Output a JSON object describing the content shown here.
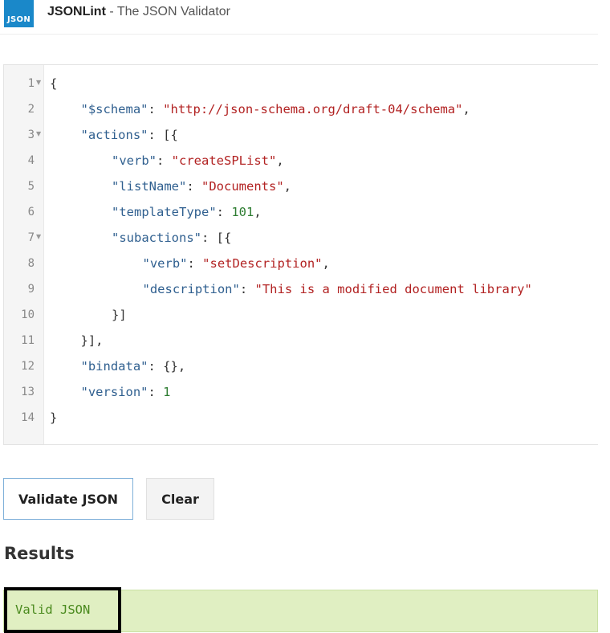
{
  "header": {
    "logo_text": "JSON",
    "brand": "JSONLint",
    "separator": " - ",
    "subtitle": "The JSON Validator"
  },
  "editor": {
    "lines": [
      {
        "num": "1",
        "fold": true,
        "indent": 0,
        "tokens": [
          {
            "t": "{",
            "c": "p"
          }
        ]
      },
      {
        "num": "2",
        "fold": false,
        "indent": 1,
        "tokens": [
          {
            "t": "\"$schema\"",
            "c": "key"
          },
          {
            "t": ": ",
            "c": "p"
          },
          {
            "t": "\"http://json-schema.org/draft-04/schema\"",
            "c": "str"
          },
          {
            "t": ",",
            "c": "p"
          }
        ]
      },
      {
        "num": "3",
        "fold": true,
        "indent": 1,
        "tokens": [
          {
            "t": "\"actions\"",
            "c": "key"
          },
          {
            "t": ": [{",
            "c": "p"
          }
        ]
      },
      {
        "num": "4",
        "fold": false,
        "indent": 2,
        "tokens": [
          {
            "t": "\"verb\"",
            "c": "key"
          },
          {
            "t": ": ",
            "c": "p"
          },
          {
            "t": "\"createSPList\"",
            "c": "str"
          },
          {
            "t": ",",
            "c": "p"
          }
        ]
      },
      {
        "num": "5",
        "fold": false,
        "indent": 2,
        "tokens": [
          {
            "t": "\"listName\"",
            "c": "key"
          },
          {
            "t": ": ",
            "c": "p"
          },
          {
            "t": "\"Documents\"",
            "c": "str"
          },
          {
            "t": ",",
            "c": "p"
          }
        ]
      },
      {
        "num": "6",
        "fold": false,
        "indent": 2,
        "tokens": [
          {
            "t": "\"templateType\"",
            "c": "key"
          },
          {
            "t": ": ",
            "c": "p"
          },
          {
            "t": "101",
            "c": "num"
          },
          {
            "t": ",",
            "c": "p"
          }
        ]
      },
      {
        "num": "7",
        "fold": true,
        "indent": 2,
        "tokens": [
          {
            "t": "\"subactions\"",
            "c": "key"
          },
          {
            "t": ": [{",
            "c": "p"
          }
        ]
      },
      {
        "num": "8",
        "fold": false,
        "indent": 3,
        "tokens": [
          {
            "t": "\"verb\"",
            "c": "key"
          },
          {
            "t": ": ",
            "c": "p"
          },
          {
            "t": "\"setDescription\"",
            "c": "str"
          },
          {
            "t": ",",
            "c": "p"
          }
        ]
      },
      {
        "num": "9",
        "fold": false,
        "indent": 3,
        "tokens": [
          {
            "t": "\"description\"",
            "c": "key"
          },
          {
            "t": ": ",
            "c": "p"
          },
          {
            "t": "\"This is a modified document library\"",
            "c": "str"
          }
        ]
      },
      {
        "num": "10",
        "fold": false,
        "indent": 2,
        "tokens": [
          {
            "t": "}]",
            "c": "p"
          }
        ]
      },
      {
        "num": "11",
        "fold": false,
        "indent": 1,
        "tokens": [
          {
            "t": "}],",
            "c": "p"
          }
        ]
      },
      {
        "num": "12",
        "fold": false,
        "indent": 1,
        "tokens": [
          {
            "t": "\"bindata\"",
            "c": "key"
          },
          {
            "t": ": {},",
            "c": "p"
          }
        ]
      },
      {
        "num": "13",
        "fold": false,
        "indent": 1,
        "tokens": [
          {
            "t": "\"version\"",
            "c": "key"
          },
          {
            "t": ": ",
            "c": "p"
          },
          {
            "t": "1",
            "c": "num"
          }
        ]
      },
      {
        "num": "14",
        "fold": false,
        "indent": 0,
        "tokens": [
          {
            "t": "}",
            "c": "p"
          }
        ]
      }
    ]
  },
  "buttons": {
    "validate_label": "Validate JSON",
    "clear_label": "Clear"
  },
  "results": {
    "heading": "Results",
    "message": "Valid JSON"
  },
  "colors": {
    "logo": "#1a88c9",
    "key": "#2f5f8f",
    "string": "#b22222",
    "number": "#2e7d32",
    "valid_bg": "#e0efc2",
    "valid_text": "#4a8a1e"
  }
}
